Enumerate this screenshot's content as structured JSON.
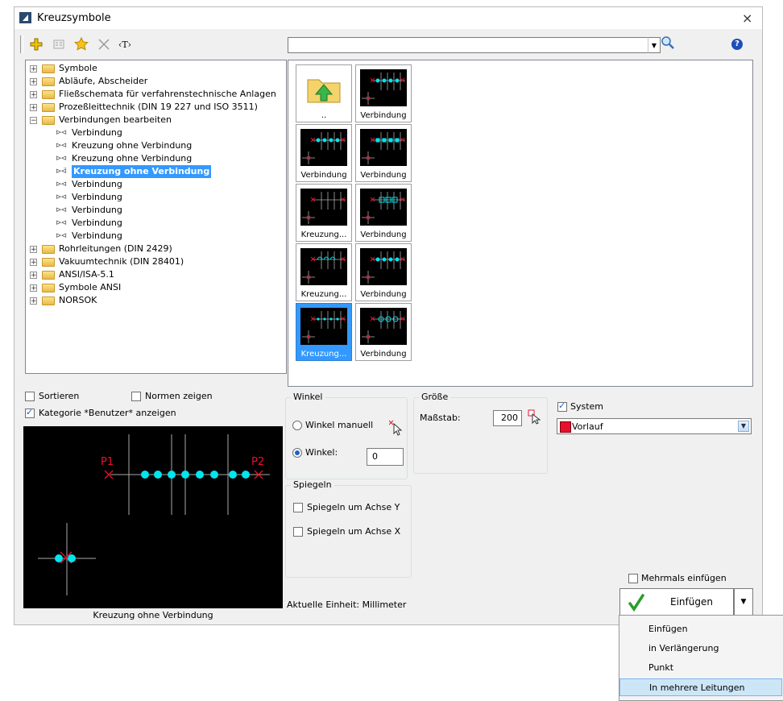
{
  "window": {
    "title": "Kreuzsymbole",
    "close_glyph": "×"
  },
  "toolbar": {
    "text_tool_label": "‹T›",
    "icons": [
      "add-icon",
      "properties-icon",
      "favorite-star-icon",
      "delete-x-icon",
      "text-icon",
      "search-icon",
      "help-icon"
    ],
    "help_glyph": "?"
  },
  "search": {
    "value": ""
  },
  "tree": {
    "items": [
      {
        "label": "Symbole",
        "type": "folder",
        "expanded": false
      },
      {
        "label": "Abläufe, Abscheider",
        "type": "folder",
        "expanded": false
      },
      {
        "label": "Fließschemata für verfahrenstechnische Anlagen",
        "type": "folder",
        "expanded": false
      },
      {
        "label": "Prozeßleittechnik (DIN 19 227 und ISO 3511)",
        "type": "folder",
        "expanded": false
      },
      {
        "label": "Verbindungen bearbeiten",
        "type": "folder",
        "expanded": true
      },
      {
        "label": "Verbindung",
        "type": "symbol"
      },
      {
        "label": "Kreuzung ohne Verbindung",
        "type": "symbol"
      },
      {
        "label": "Kreuzung ohne Verbindung",
        "type": "symbol"
      },
      {
        "label": "Kreuzung ohne Verbindung",
        "type": "symbol",
        "selected": true
      },
      {
        "label": "Verbindung",
        "type": "symbol"
      },
      {
        "label": "Verbindung",
        "type": "symbol"
      },
      {
        "label": "Verbindung",
        "type": "symbol"
      },
      {
        "label": "Verbindung",
        "type": "symbol"
      },
      {
        "label": "Verbindung",
        "type": "symbol"
      },
      {
        "label": "Rohrleitungen (DIN 2429)",
        "type": "folder",
        "expanded": false
      },
      {
        "label": "Vakuumtechnik (DIN 28401)",
        "type": "folder",
        "expanded": false
      },
      {
        "label": "ANSI/ISA-5.1",
        "type": "folder",
        "expanded": false
      },
      {
        "label": "Symbole ANSI",
        "type": "folder",
        "expanded": false
      },
      {
        "label": "NORSOK",
        "type": "folder",
        "expanded": false
      }
    ]
  },
  "gallery": {
    "tiles": [
      {
        "label": "..",
        "kind": "up-folder"
      },
      {
        "label": "Verbindung",
        "kind": "dots"
      },
      {
        "label": "Verbindung",
        "kind": "dots"
      },
      {
        "label": "Verbindung",
        "kind": "squares"
      },
      {
        "label": "Kreuzung...",
        "kind": "plain"
      },
      {
        "label": "Verbindung",
        "kind": "boxes"
      },
      {
        "label": "Kreuzung...",
        "kind": "arcs"
      },
      {
        "label": "Verbindung",
        "kind": "dots"
      },
      {
        "label": "Kreuzung...",
        "kind": "smalldots",
        "selected": true
      },
      {
        "label": "Verbindung",
        "kind": "rings"
      }
    ]
  },
  "options": {
    "sortieren_label": "Sortieren",
    "sortieren_checked": false,
    "normen_label": "Normen zeigen",
    "normen_checked": false,
    "kategorie_label": "Kategorie *Benutzer* anzeigen",
    "kategorie_checked": true
  },
  "preview": {
    "caption": "Kreuzung ohne Verbindung",
    "p1": "P1",
    "p2": "P2"
  },
  "winkel": {
    "group_label": "Winkel",
    "manual_label": "Winkel manuell",
    "manual_selected": false,
    "angle_label": "Winkel:",
    "angle_selected": true,
    "angle_value": "0"
  },
  "groesse": {
    "group_label": "Größe",
    "scale_label": "Maßstab:",
    "scale_value": "200"
  },
  "spiegeln": {
    "group_label": "Spiegeln",
    "y_label": "Spiegeln um Achse Y",
    "y_checked": false,
    "x_label": "Spiegeln um Achse X",
    "x_checked": false
  },
  "system": {
    "label": "System",
    "checked": true,
    "selected_value": "Vorlauf",
    "swatch_color": "#e8112d"
  },
  "footer": {
    "unit_text": "Aktuelle Einheit: Millimeter",
    "mehrmals_label": "Mehrmals einfügen",
    "mehrmals_checked": false,
    "insert_label": "Einfügen"
  },
  "dropdown_menu": {
    "items": [
      "Einfügen",
      "in Verlängerung",
      "Punkt",
      "In mehrere Leitungen"
    ],
    "highlighted_index": 3
  },
  "colors": {
    "accent": "#3399ff",
    "symbol_cyan": "#00e5ee",
    "symbol_red": "#e8112d",
    "check_green": "#2a9d2a"
  }
}
